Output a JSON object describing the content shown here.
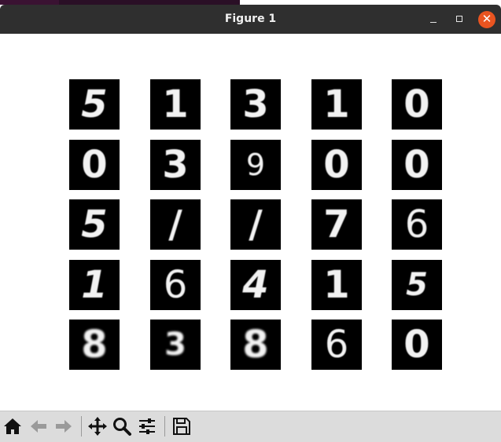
{
  "window": {
    "title": "Figure 1"
  },
  "titlebar_buttons": {
    "minimize": "minimize-icon",
    "maximize": "maximize-icon",
    "close": "close-icon"
  },
  "colors": {
    "titlebar": "#2f2f2f",
    "close_button": "#e95420",
    "toolbar": "#dcdcdc",
    "tile_background": "#000000",
    "digit_stroke": "#f2f2f2"
  },
  "grid": {
    "rows": [
      [
        "5",
        "1",
        "3",
        "1",
        "0"
      ],
      [
        "0",
        "3",
        "9",
        "0",
        "0"
      ],
      [
        "5",
        "/",
        "/",
        "7",
        "6"
      ],
      [
        "1",
        "6",
        "4",
        "1",
        "5"
      ],
      [
        "8",
        "3",
        "8",
        "6",
        "0"
      ]
    ]
  },
  "toolbar": {
    "tools": [
      "home-icon",
      "back-arrow-icon",
      "forward-arrow-icon",
      "pan-move-icon",
      "zoom-magnifier-icon",
      "configure-subplots-icon",
      "save-figure-icon"
    ]
  }
}
